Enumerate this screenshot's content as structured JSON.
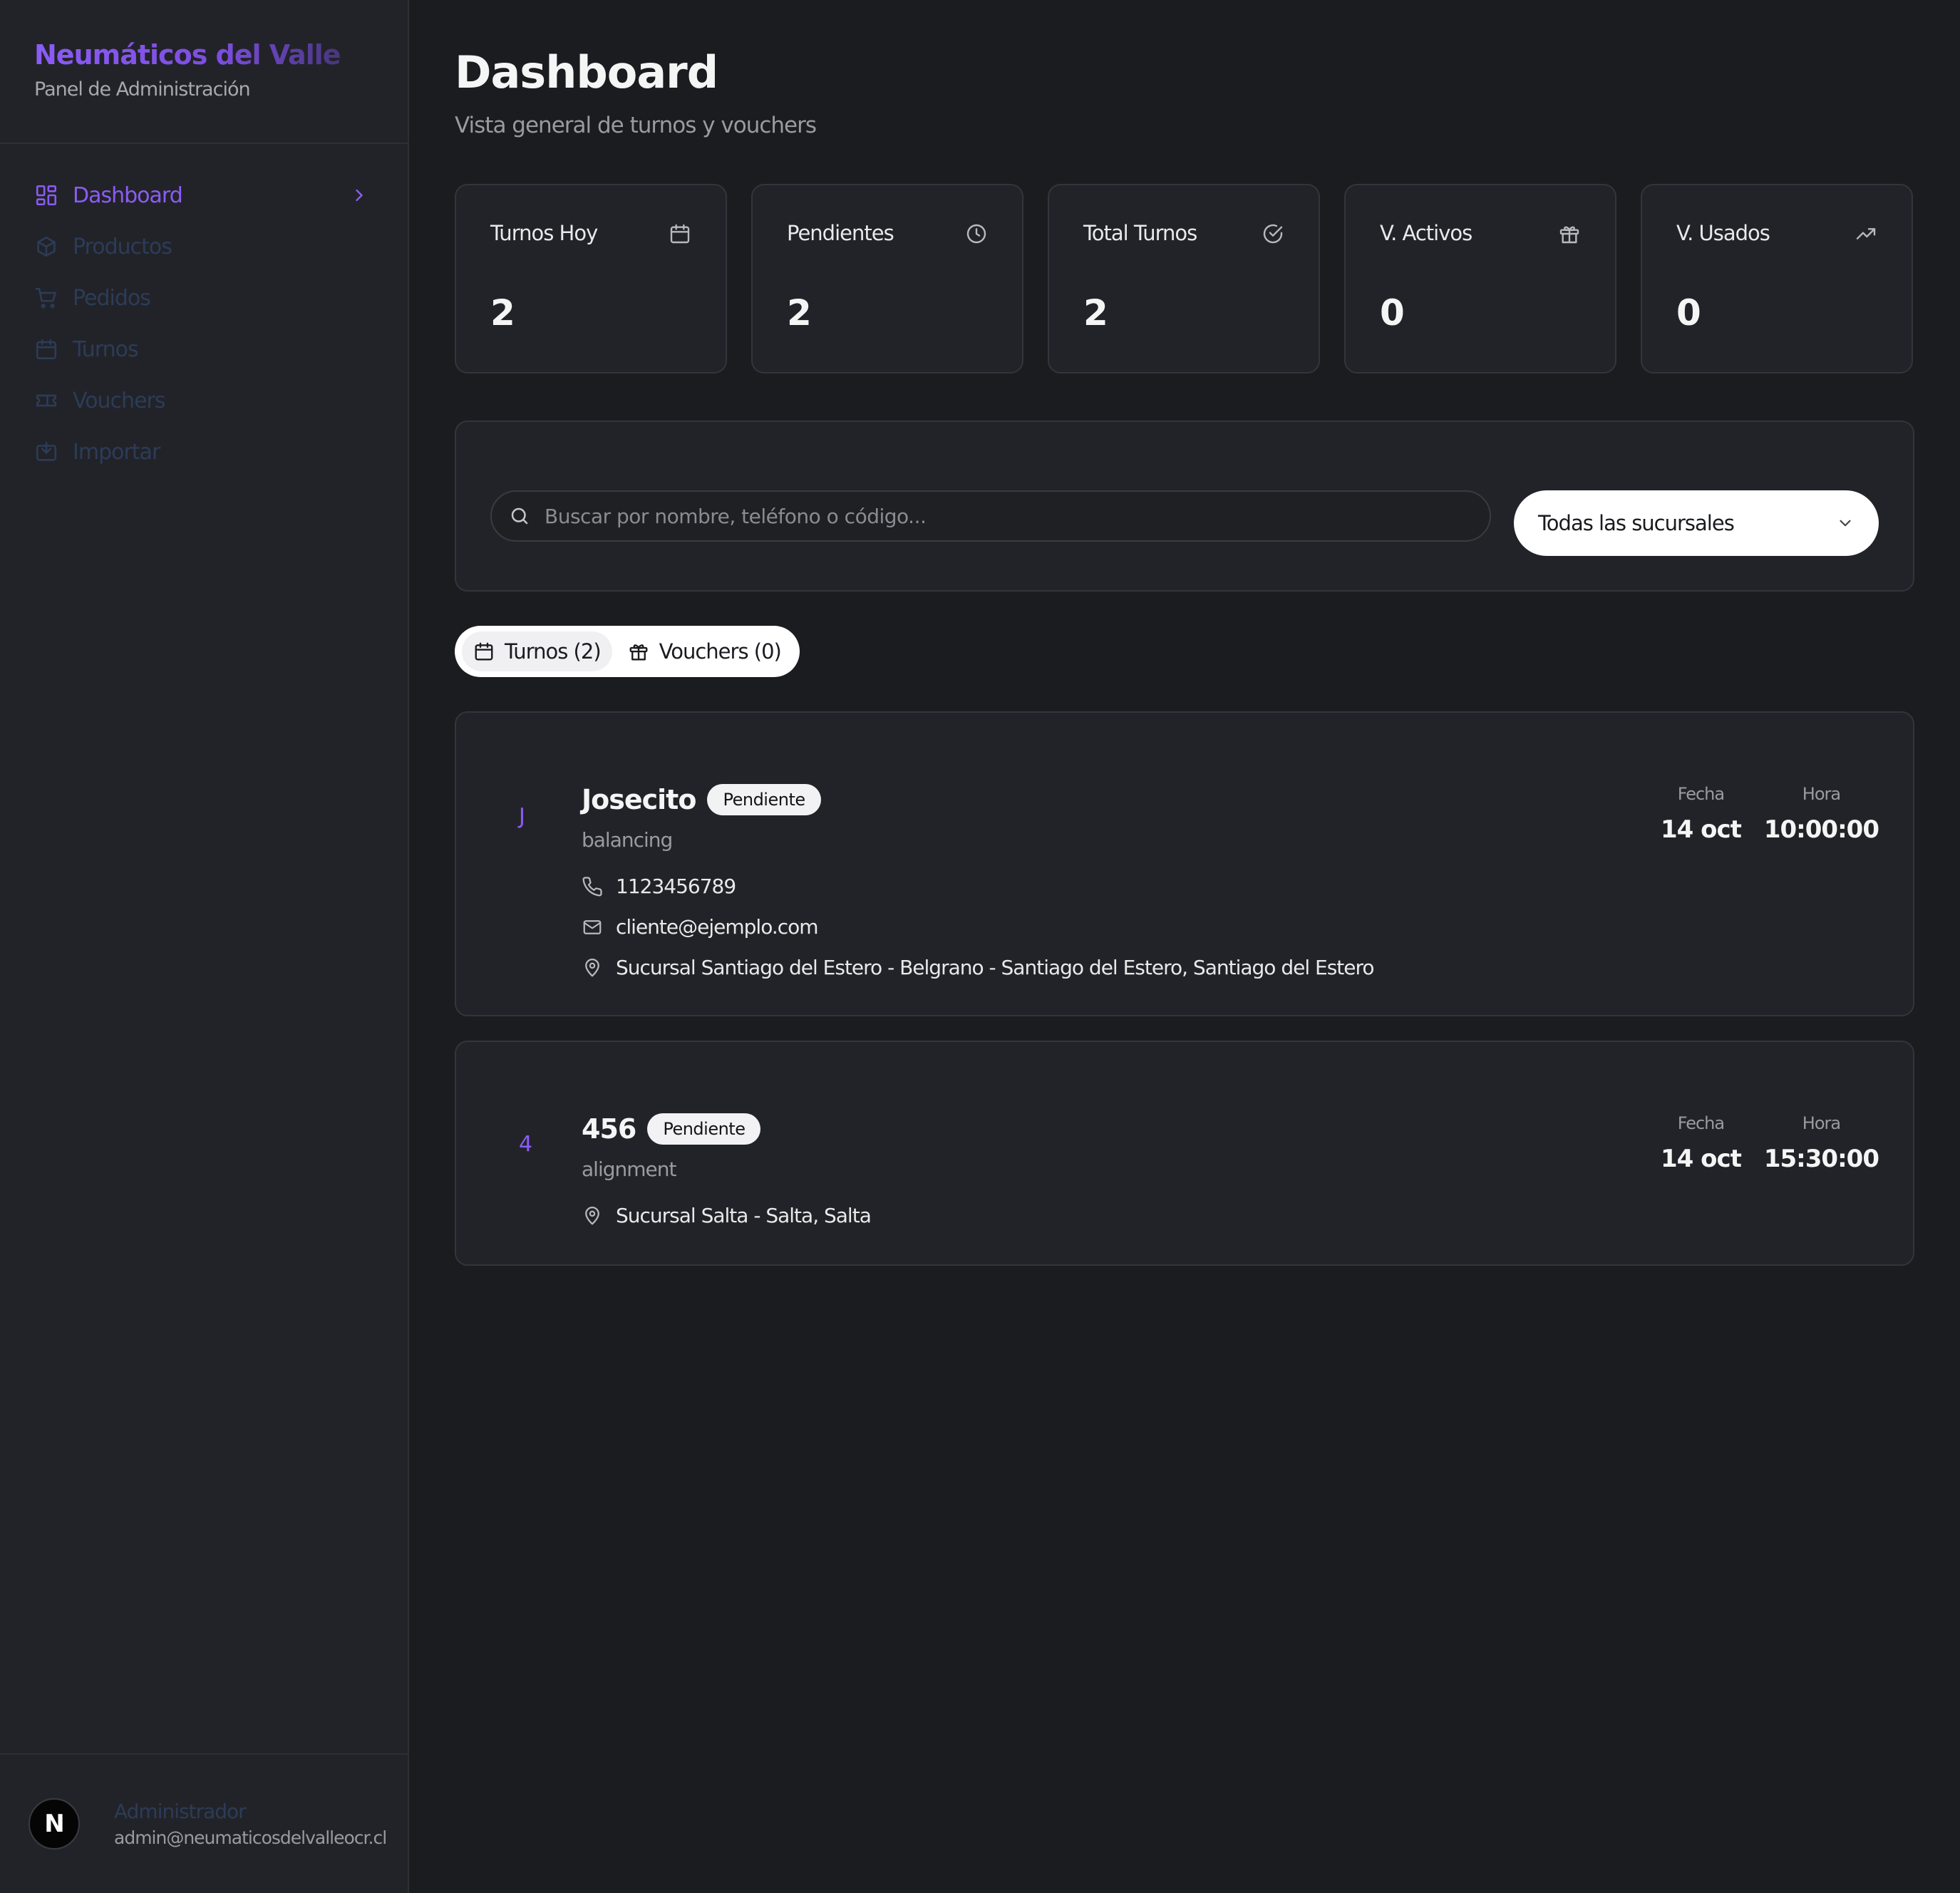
{
  "brand": {
    "title": "Neumáticos del Valle",
    "subtitle": "Panel de Administración"
  },
  "nav": [
    {
      "label": "Dashboard",
      "icon": "layout-dashboard-icon",
      "active": true
    },
    {
      "label": "Productos",
      "icon": "package-icon"
    },
    {
      "label": "Pedidos",
      "icon": "shopping-cart-icon"
    },
    {
      "label": "Turnos",
      "icon": "calendar-icon"
    },
    {
      "label": "Vouchers",
      "icon": "ticket-icon"
    },
    {
      "label": "Importar",
      "icon": "import-icon"
    }
  ],
  "user": {
    "avatar_letter": "N",
    "name": "Administrador",
    "email": "admin@neumaticosdelvalleocr.cl"
  },
  "header": {
    "title": "Dashboard",
    "subtitle": "Vista general de turnos y vouchers"
  },
  "stats": [
    {
      "label": "Turnos Hoy",
      "value": "2",
      "icon": "calendar-icon"
    },
    {
      "label": "Pendientes",
      "value": "2",
      "icon": "clock-icon"
    },
    {
      "label": "Total Turnos",
      "value": "2",
      "icon": "check-circle-icon"
    },
    {
      "label": "V. Activos",
      "value": "0",
      "icon": "gift-icon"
    },
    {
      "label": "V. Usados",
      "value": "0",
      "icon": "trending-up-icon"
    }
  ],
  "filters": {
    "search_placeholder": "Buscar por nombre, teléfono o código...",
    "branch_selected": "Todas las sucursales"
  },
  "tabs": [
    {
      "label": "Turnos (2)",
      "icon": "calendar-icon",
      "active": true
    },
    {
      "label": "Vouchers (0)",
      "icon": "gift-icon"
    }
  ],
  "appointments": [
    {
      "initial": "J",
      "name": "Josecito",
      "status": "Pendiente",
      "service": "balancing",
      "phone": "1123456789",
      "email": "cliente@ejemplo.com",
      "location": "Sucursal Santiago del Estero - Belgrano - Santiago del Estero, Santiago del Estero",
      "date_label": "Fecha",
      "date": "14 oct",
      "time_label": "Hora",
      "time": "10:00:00"
    },
    {
      "initial": "4",
      "name": "456",
      "status": "Pendiente",
      "service": "alignment",
      "location": "Sucursal Salta - Salta, Salta",
      "date_label": "Fecha",
      "date": "14 oct",
      "time_label": "Hora",
      "time": "15:30:00"
    }
  ],
  "colors": {
    "accent": "#8b5cf6",
    "background": "#1b1c20",
    "card": "#222328",
    "muted_nav": "#2c3c58"
  }
}
